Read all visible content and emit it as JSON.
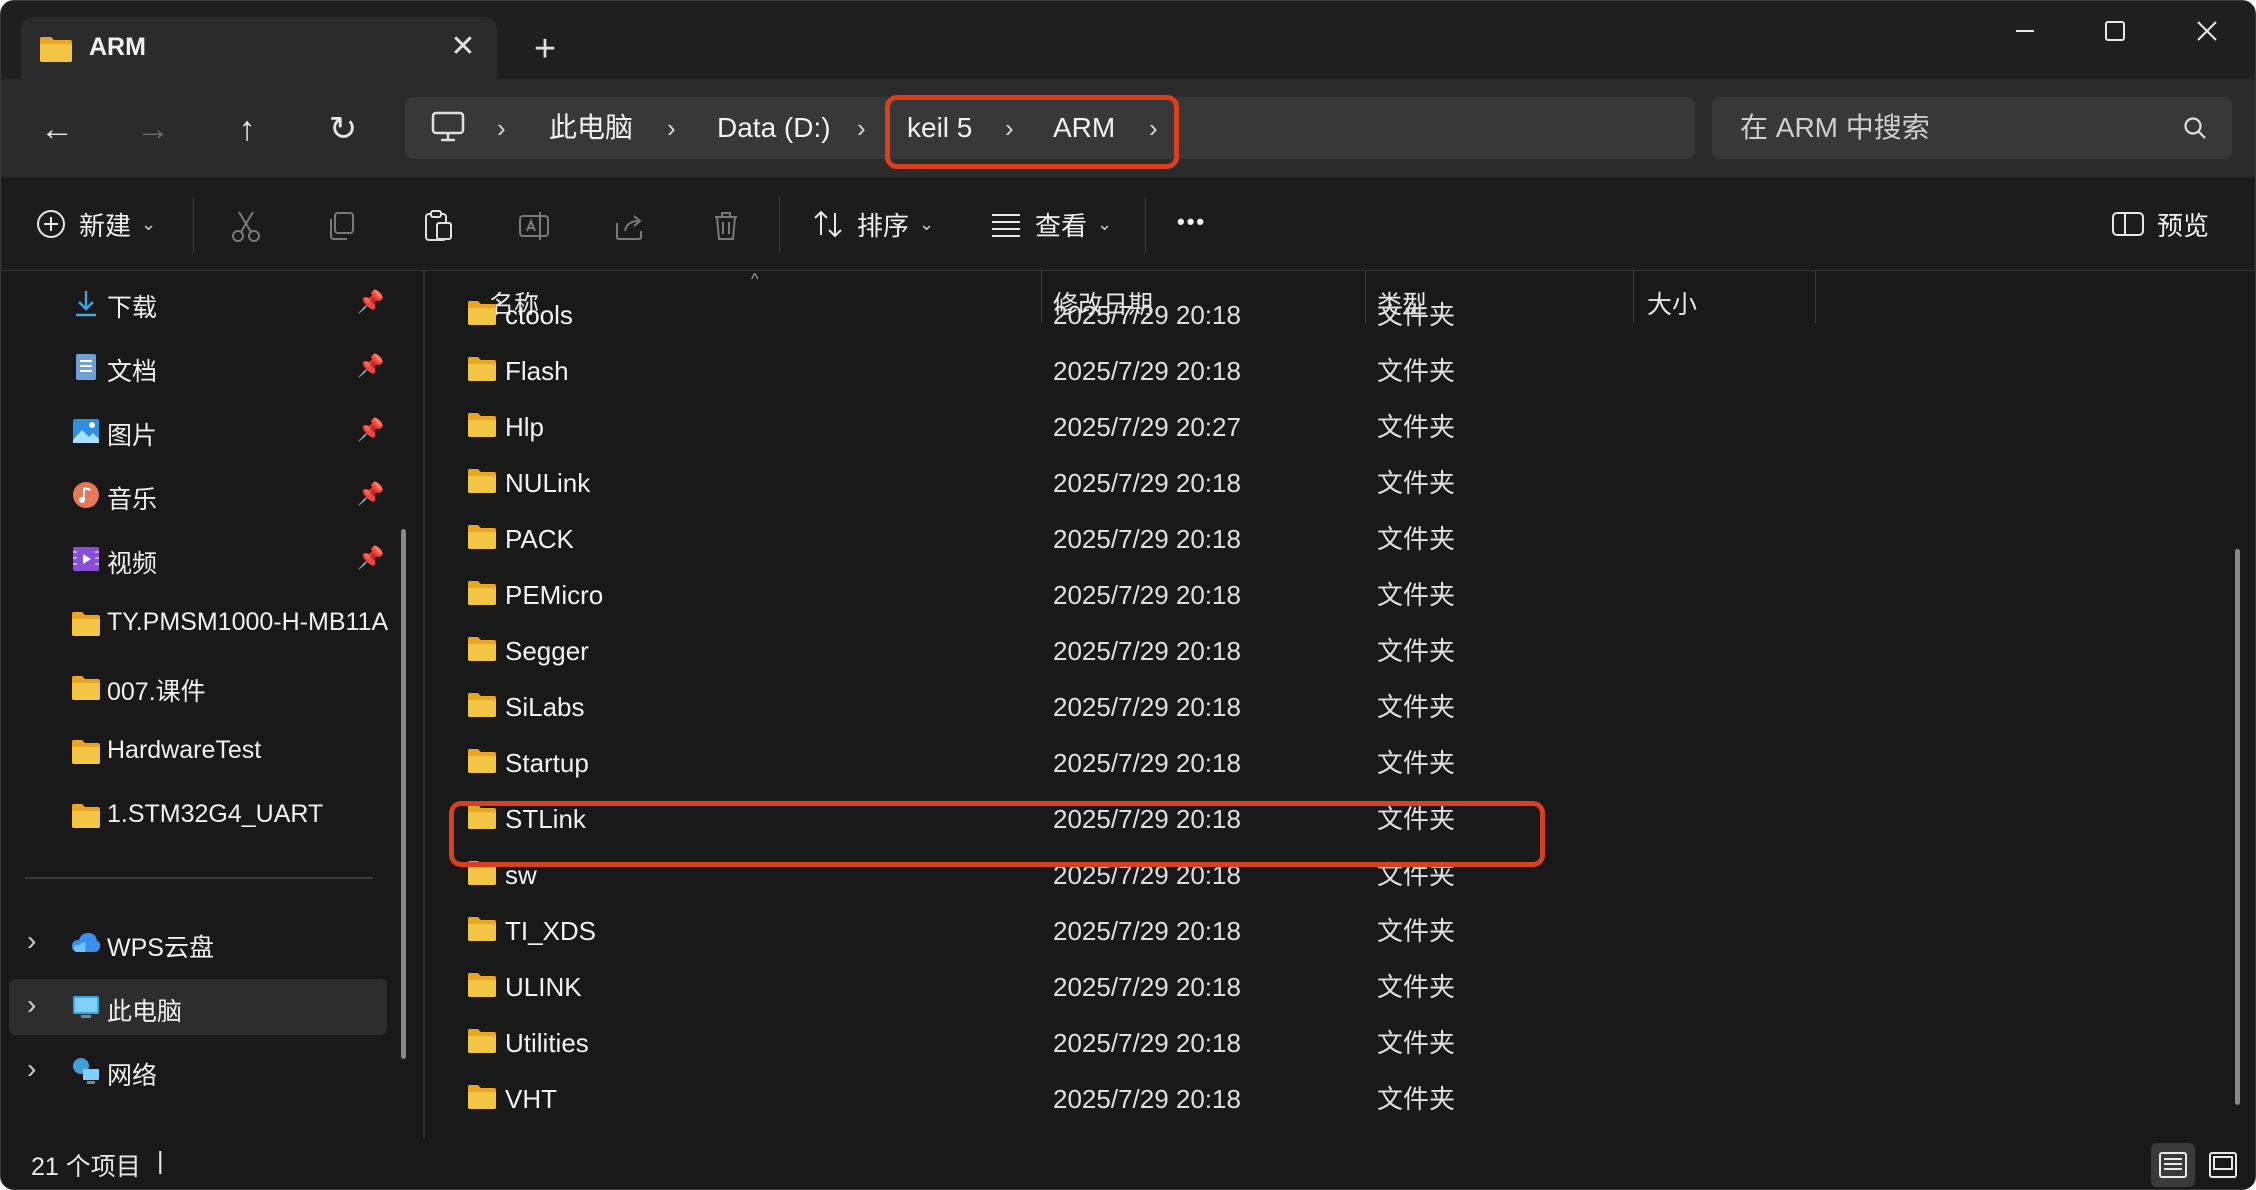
{
  "window": {
    "tab_title": "ARM",
    "close_tab": "✕",
    "new_tab": "+",
    "minimize": "—",
    "maximize": "☐",
    "close": "✕"
  },
  "nav": {
    "back": "←",
    "forward": "→",
    "up": "↑",
    "refresh": "↻"
  },
  "breadcrumbs": [
    "此电脑",
    "Data (D:)",
    "keil 5",
    "ARM"
  ],
  "search": {
    "placeholder": "在 ARM 中搜索"
  },
  "commands": {
    "new": "新建",
    "sort": "排序",
    "view": "查看",
    "more": "•••",
    "preview": "预览"
  },
  "sidebar": {
    "quick_access": [
      {
        "label": "下载",
        "icon": "download-icon"
      },
      {
        "label": "文档",
        "icon": "document-icon"
      },
      {
        "label": "图片",
        "icon": "pictures-icon"
      },
      {
        "label": "音乐",
        "icon": "music-icon"
      },
      {
        "label": "视频",
        "icon": "video-icon"
      },
      {
        "label": "TY.PMSM1000-H-MB11A",
        "icon": "folder-icon"
      },
      {
        "label": "007.课件",
        "icon": "folder-icon"
      },
      {
        "label": "HardwareTest",
        "icon": "folder-icon"
      },
      {
        "label": "1.STM32G4_UART",
        "icon": "folder-icon"
      }
    ],
    "locations": [
      {
        "label": "WPS云盘",
        "icon": "cloud-icon"
      },
      {
        "label": "此电脑",
        "icon": "computer-icon",
        "selected": true
      },
      {
        "label": "网络",
        "icon": "network-icon"
      }
    ]
  },
  "columns": [
    "名称",
    "修改日期",
    "类型",
    "大小"
  ],
  "files": [
    {
      "name": "ctools",
      "date": "2025/7/29 20:18",
      "type": "文件夹"
    },
    {
      "name": "Flash",
      "date": "2025/7/29 20:18",
      "type": "文件夹"
    },
    {
      "name": "Hlp",
      "date": "2025/7/29 20:27",
      "type": "文件夹"
    },
    {
      "name": "NULink",
      "date": "2025/7/29 20:18",
      "type": "文件夹"
    },
    {
      "name": "PACK",
      "date": "2025/7/29 20:18",
      "type": "文件夹"
    },
    {
      "name": "PEMicro",
      "date": "2025/7/29 20:18",
      "type": "文件夹"
    },
    {
      "name": "Segger",
      "date": "2025/7/29 20:18",
      "type": "文件夹"
    },
    {
      "name": "SiLabs",
      "date": "2025/7/29 20:18",
      "type": "文件夹"
    },
    {
      "name": "Startup",
      "date": "2025/7/29 20:18",
      "type": "文件夹"
    },
    {
      "name": "STLink",
      "date": "2025/7/29 20:18",
      "type": "文件夹",
      "highlighted": true
    },
    {
      "name": "sw",
      "date": "2025/7/29 20:18",
      "type": "文件夹"
    },
    {
      "name": "TI_XDS",
      "date": "2025/7/29 20:18",
      "type": "文件夹"
    },
    {
      "name": "ULINK",
      "date": "2025/7/29 20:18",
      "type": "文件夹"
    },
    {
      "name": "Utilities",
      "date": "2025/7/29 20:18",
      "type": "文件夹"
    },
    {
      "name": "VHT",
      "date": "2025/7/29 20:18",
      "type": "文件夹"
    }
  ],
  "status": {
    "item_count": "21 个项目",
    "cursor": "|"
  },
  "colors": {
    "accent_highlight": "#d9411e",
    "folder": "#f4c542",
    "background": "#191919"
  }
}
